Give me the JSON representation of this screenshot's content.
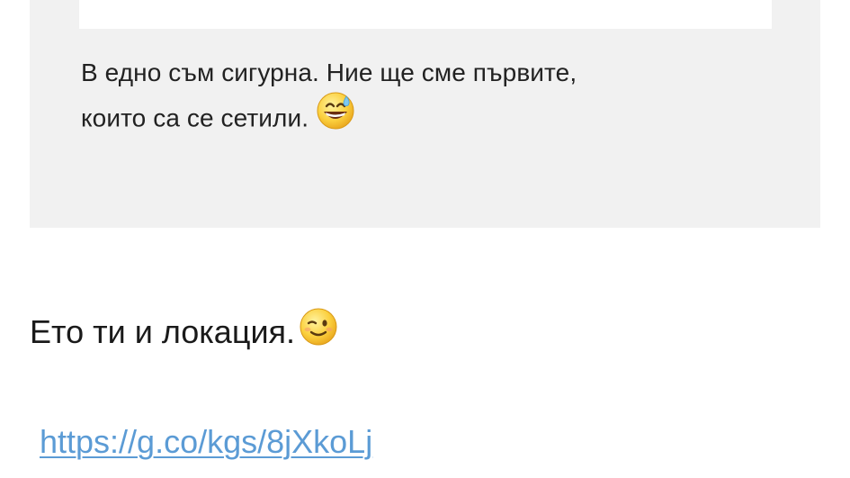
{
  "quote": {
    "line1": "В едно съм сигурна. Ние ще сме първите,",
    "line2": "които са се сетили.",
    "emoji_icon": "grinning-sweat-emoji"
  },
  "message": {
    "text": "Ето ти и локация.",
    "emoji_icon": "winking-face-emoji"
  },
  "link": {
    "text": "https://g.co/kgs/8jXkoLj",
    "color": "#5b9bd5"
  }
}
